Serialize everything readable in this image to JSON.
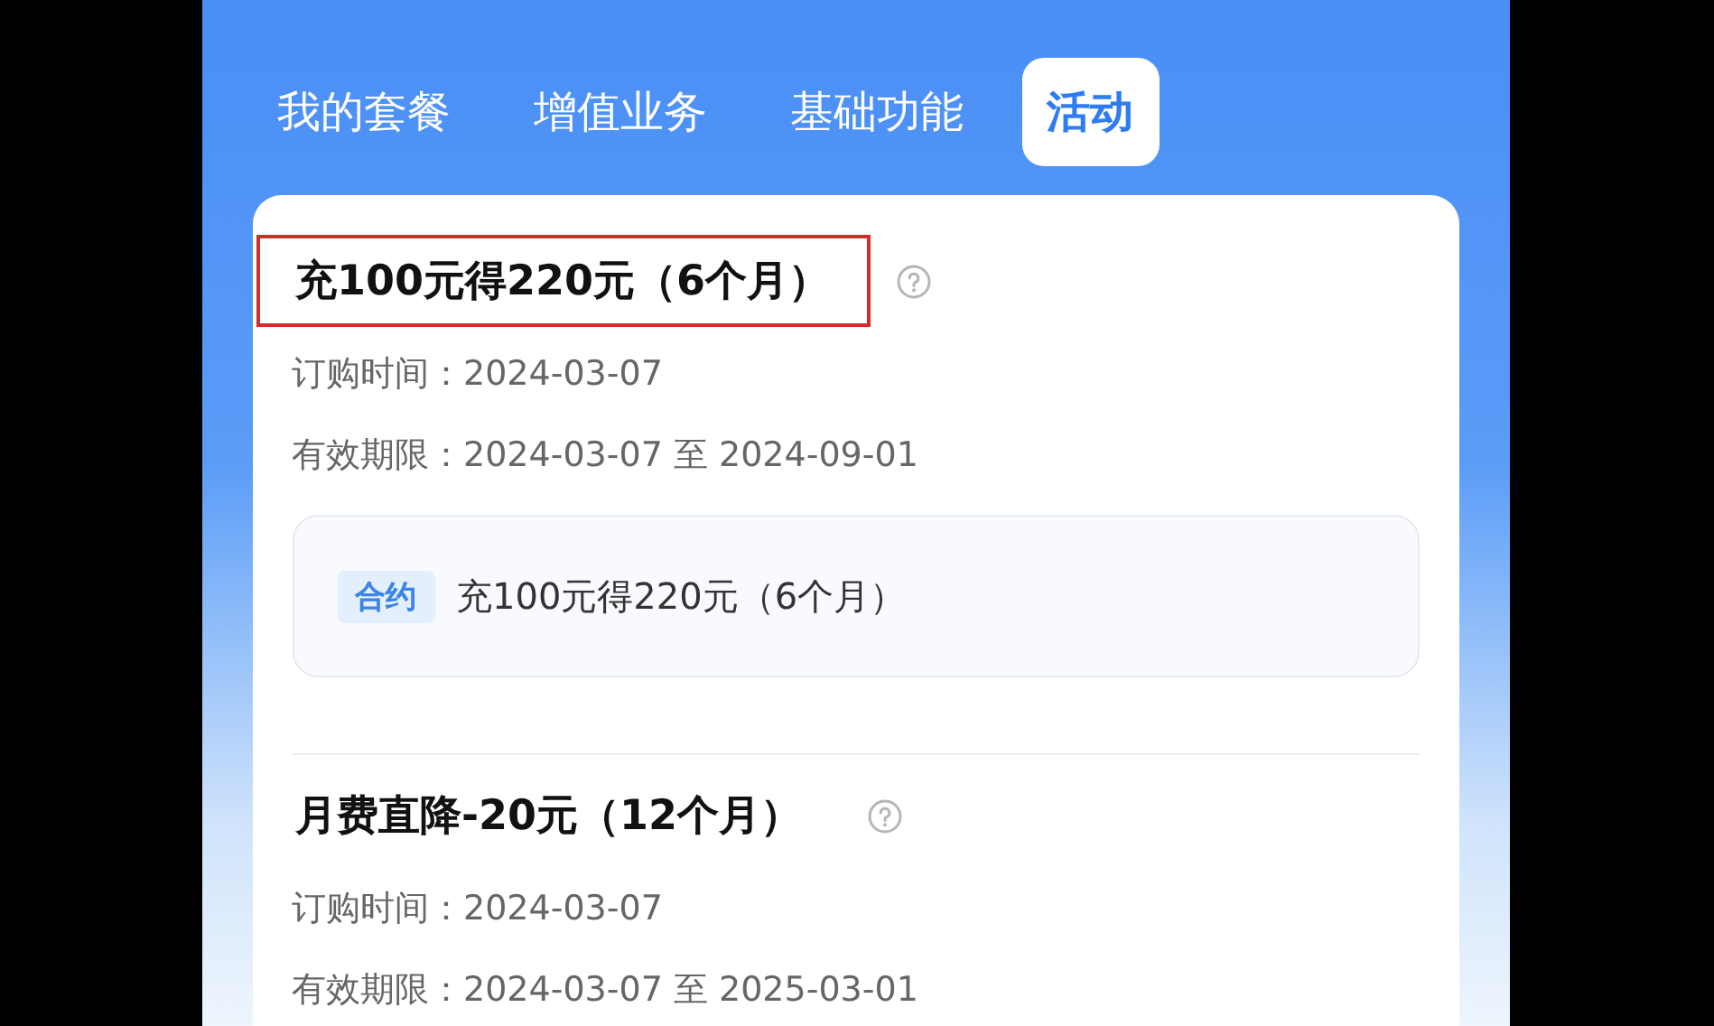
{
  "tabs": [
    {
      "label": "我的套餐",
      "selected": false
    },
    {
      "label": "增值业务",
      "selected": false
    },
    {
      "label": "基础功能",
      "selected": false
    },
    {
      "label": "活动",
      "selected": true
    }
  ],
  "activities": [
    {
      "title": "充100元得220元（6个月）",
      "highlighted": true,
      "order_label": "订购时间：",
      "order_date": "2024-03-07",
      "validity_label": "有效期限：",
      "validity": "2024-03-07 至 2024-09-01",
      "detail": {
        "tag": "合约",
        "text": "充100元得220元（6个月）"
      }
    },
    {
      "title": "月费直降-20元（12个月）",
      "highlighted": false,
      "order_label": "订购时间：",
      "order_date": "2024-03-07",
      "validity_label": "有效期限：",
      "validity": "2024-03-07 至 2025-03-01"
    }
  ]
}
